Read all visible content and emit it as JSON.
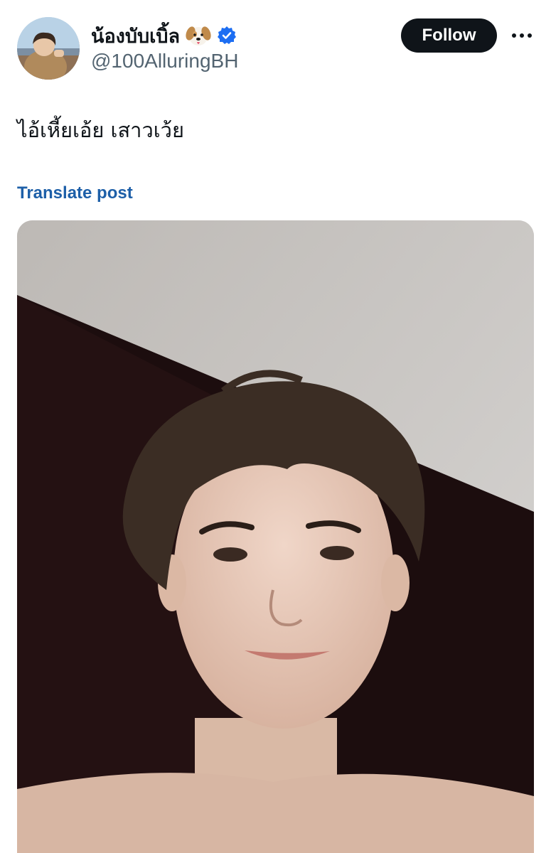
{
  "user": {
    "display_name": "น้องบับเบิ้ล",
    "handle": "@100AlluringBH",
    "verified": true,
    "name_emoji": "dog-face",
    "verified_color": "#1d6ef2"
  },
  "actions": {
    "follow_label": "Follow",
    "more_icon": "more-horizontal-icon"
  },
  "post": {
    "text": "ไอ้เหี้ยเอ้ย เสาวเว้ย",
    "translate_label": "Translate post"
  },
  "colors": {
    "follow_bg": "#0f1419",
    "link": "#1d5fa8",
    "handle": "#536471"
  }
}
